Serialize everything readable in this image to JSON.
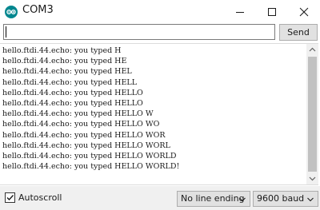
{
  "window": {
    "title": "COM3"
  },
  "input": {
    "value": "",
    "send_label": "Send"
  },
  "output": {
    "lines": [
      "hello.ftdi.44.echo: you typed H",
      "hello.ftdi.44.echo: you typed HE",
      "hello.ftdi.44.echo: you typed HEL",
      "hello.ftdi.44.echo: you typed HELL",
      "hello.ftdi.44.echo: you typed HELLO",
      "hello.ftdi.44.echo: you typed HELLO",
      "hello.ftdi.44.echo: you typed HELLO W",
      "hello.ftdi.44.echo: you typed HELLO WO",
      "hello.ftdi.44.echo: you typed HELLO WOR",
      "hello.ftdi.44.echo: you typed HELLO WORL",
      "hello.ftdi.44.echo: you typed HELLO WORLD",
      "hello.ftdi.44.echo: you typed HELLO WORLD!"
    ]
  },
  "footer": {
    "autoscroll_label": "Autoscroll",
    "autoscroll_checked": true,
    "line_ending": "No line ending",
    "baud": "9600 baud"
  },
  "icons": {
    "app": "arduino-icon",
    "minimize": "minimize-icon",
    "maximize": "maximize-icon",
    "close": "close-icon"
  },
  "colors": {
    "app_icon": "#00878f"
  }
}
